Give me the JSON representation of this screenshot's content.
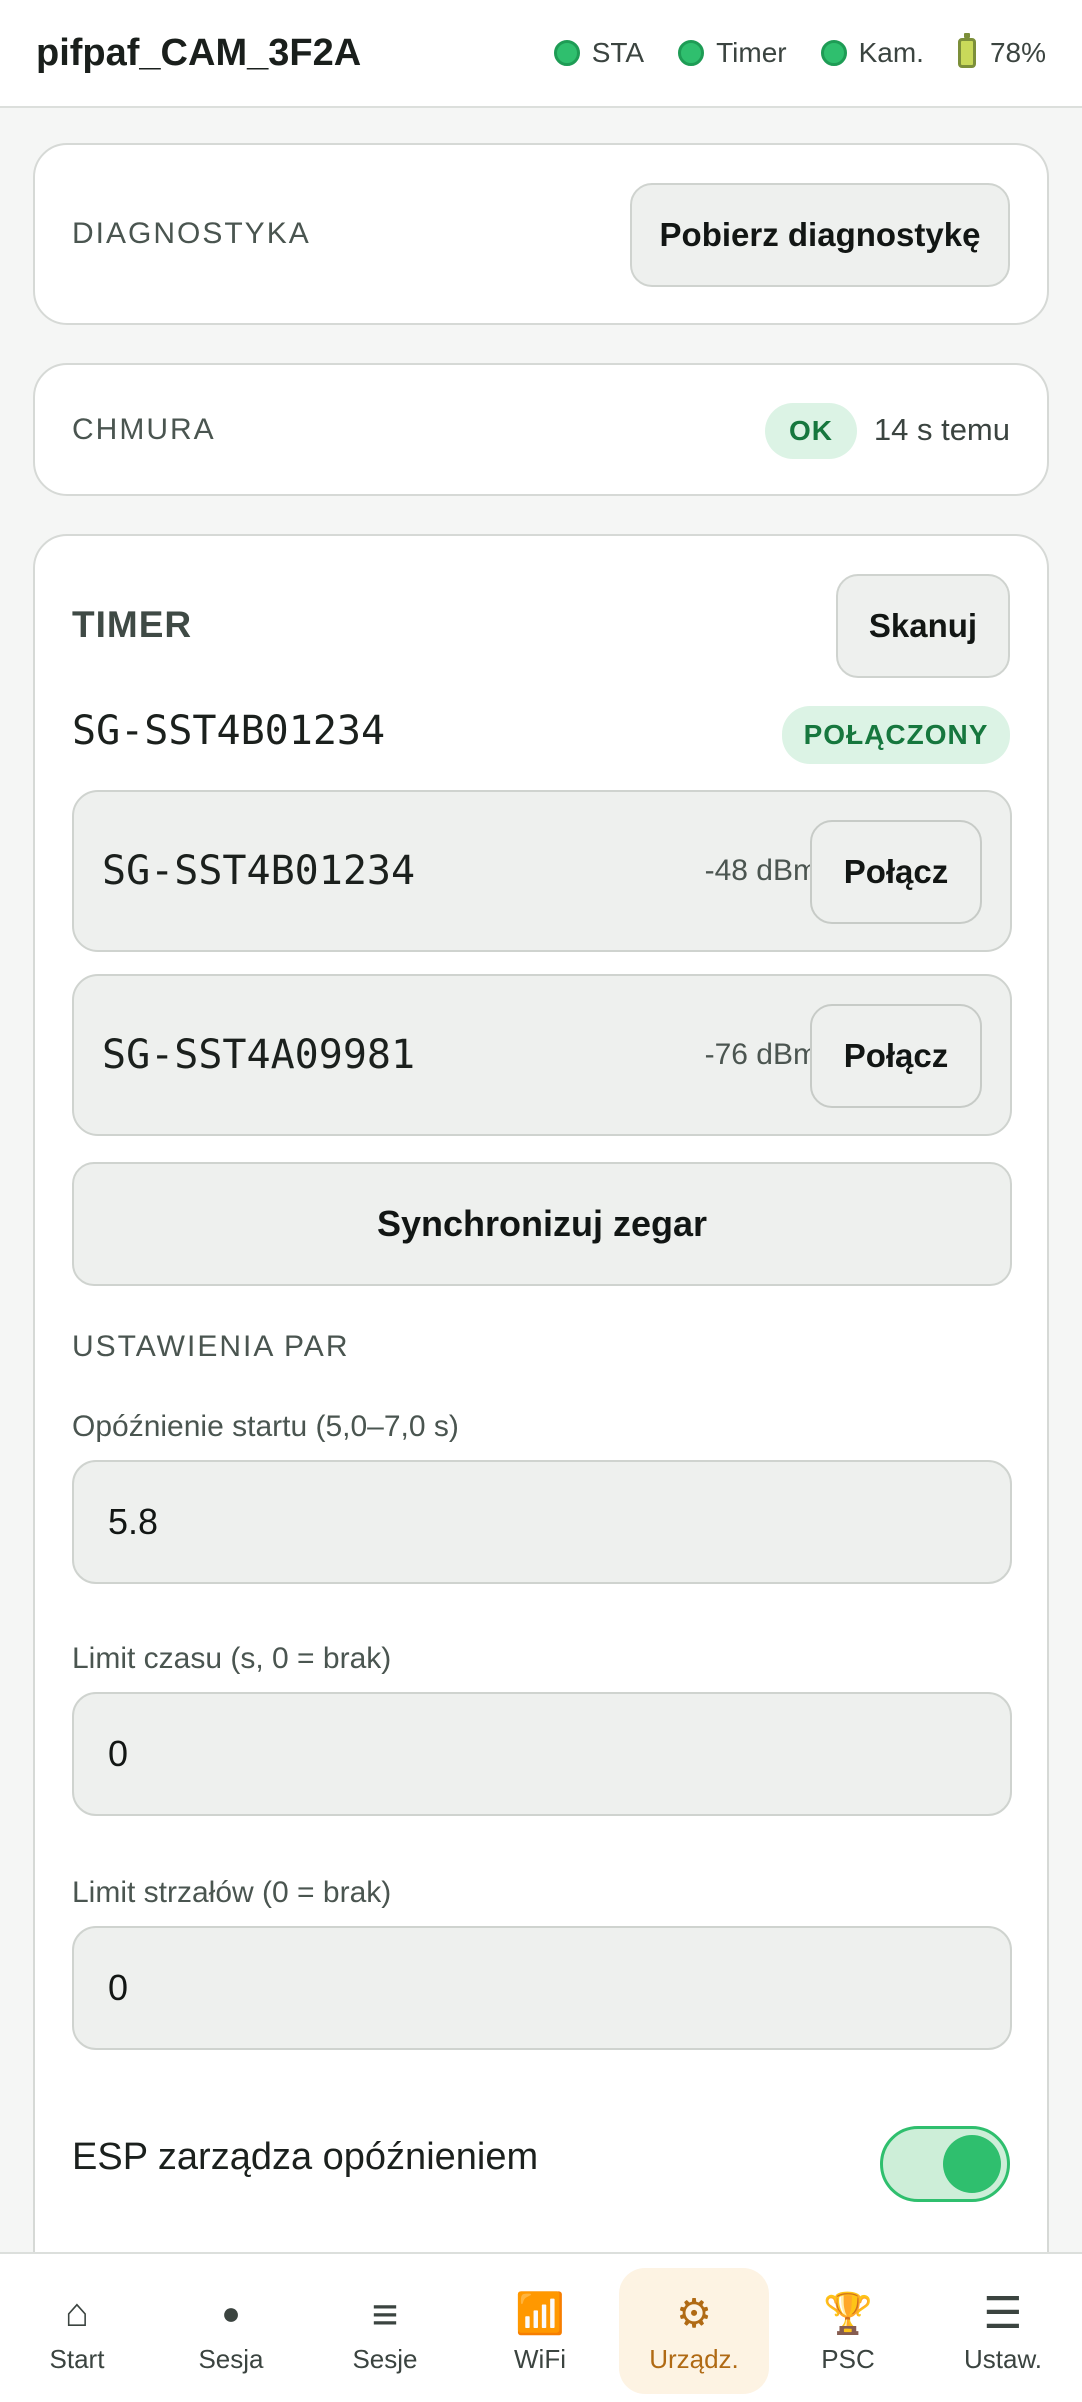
{
  "header": {
    "title": "pifpaf_CAM_3F2A",
    "status": [
      {
        "label": "STA"
      },
      {
        "label": "Timer"
      },
      {
        "label": "Kam."
      }
    ],
    "battery": "78%"
  },
  "diagnostics": {
    "label": "DIAGNOSTYKA",
    "button": "Pobierz diagnostykę"
  },
  "cloud": {
    "label": "CHMURA",
    "badge": "OK",
    "time": "14 s temu"
  },
  "timer": {
    "title": "TIMER",
    "scan_button": "Skanuj",
    "connected_name": "SG-SST4B01234",
    "connected_badge": "POŁĄCZONY",
    "devices": [
      {
        "name": "SG-SST4B01234",
        "rssi": "-48 dBm",
        "button": "Połącz"
      },
      {
        "name": "SG-SST4A09981",
        "rssi": "-76 dBm",
        "button": "Połącz"
      }
    ],
    "sync_button": "Synchronizuj zegar",
    "settings_label": "USTAWIENIA PAR",
    "fields": [
      {
        "label": "Opóźnienie startu (5,0–7,0 s)",
        "value": "5.8"
      },
      {
        "label": "Limit czasu (s, 0 = brak)",
        "value": "0"
      },
      {
        "label": "Limit strzałów (0 = brak)",
        "value": "0"
      }
    ],
    "toggle_label": "ESP zarządza opóźnieniem",
    "toggle_on": true
  },
  "nav": {
    "items": [
      {
        "icon": "home-icon",
        "glyph": "⌂",
        "label": "Start"
      },
      {
        "icon": "dot-icon",
        "glyph": "●",
        "label": "Sesja"
      },
      {
        "icon": "list-icon",
        "glyph": "≡",
        "label": "Sesje"
      },
      {
        "icon": "wifi-icon",
        "glyph": "📶",
        "label": "WiFi"
      },
      {
        "icon": "gear-icon",
        "glyph": "⚙",
        "label": "Urządz."
      },
      {
        "icon": "trophy-icon",
        "glyph": "🏆",
        "label": "PSC"
      },
      {
        "icon": "menu-icon",
        "glyph": "☰",
        "label": "Ustaw."
      }
    ],
    "active": "Urządz."
  },
  "colors": {
    "accent_green": "#2fbf6e",
    "active_nav": "#b06a14"
  }
}
